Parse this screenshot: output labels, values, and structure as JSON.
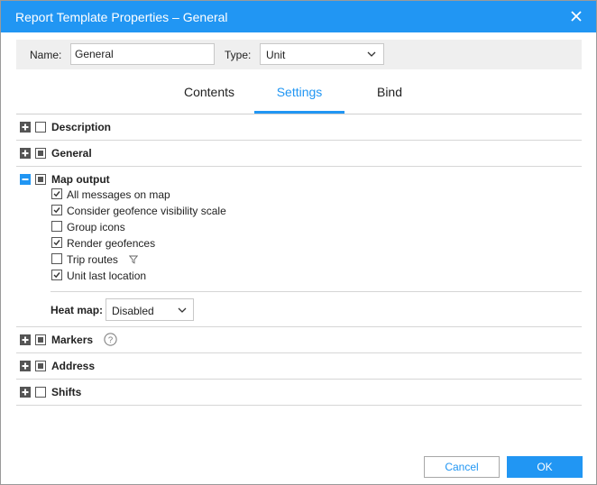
{
  "window": {
    "title": "Report Template Properties – General"
  },
  "name_bar": {
    "name_label": "Name:",
    "name_value": "General",
    "type_label": "Type:",
    "type_value": "Unit"
  },
  "tabs": [
    {
      "label": "Contents",
      "active": false
    },
    {
      "label": "Settings",
      "active": true
    },
    {
      "label": "Bind",
      "active": false
    }
  ],
  "sections": {
    "description": {
      "title": "Description",
      "expanded": false,
      "check": "unchecked"
    },
    "general": {
      "title": "General",
      "expanded": false,
      "check": "partial"
    },
    "map_output": {
      "title": "Map output",
      "expanded": true,
      "check": "partial",
      "options": [
        {
          "label": "All messages on map",
          "checked": true
        },
        {
          "label": "Consider geofence visibility scale",
          "checked": true
        },
        {
          "label": "Group icons",
          "checked": false
        },
        {
          "label": "Render geofences",
          "checked": true
        },
        {
          "label": "Trip routes",
          "checked": false,
          "icon": "filter-icon"
        },
        {
          "label": "Unit last location",
          "checked": true
        }
      ],
      "heat_map": {
        "label": "Heat map:",
        "value": "Disabled"
      }
    },
    "markers": {
      "title": "Markers",
      "expanded": false,
      "check": "partial",
      "icon": "help-icon"
    },
    "address": {
      "title": "Address",
      "expanded": false,
      "check": "partial"
    },
    "shifts": {
      "title": "Shifts",
      "expanded": false,
      "check": "unchecked"
    }
  },
  "buttons": {
    "cancel": "Cancel",
    "ok": "OK"
  },
  "colors": {
    "accent": "#2196f3",
    "name_bar_bg": "#efefef",
    "separator": "#d6d6d6"
  }
}
